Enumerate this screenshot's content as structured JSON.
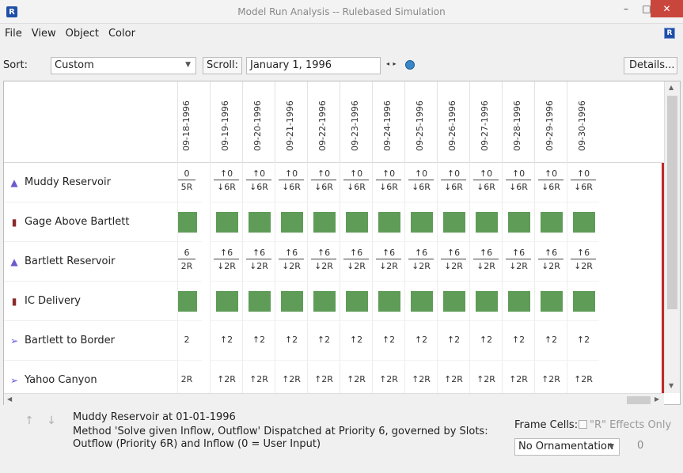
{
  "window": {
    "title": "Model Run Analysis -- Rulebased Simulation",
    "app_icon": "R",
    "minimize": "–",
    "maximize": "□",
    "close": "✕"
  },
  "menu": [
    "File",
    "View",
    "Object",
    "Color"
  ],
  "help_badge": "R",
  "toolbar": {
    "sort_label": "Sort:",
    "sort_value": "Custom",
    "scroll_label": "Scroll:",
    "date_value": "January 1, 1996",
    "nav_arrows": "◂ ▸",
    "details_label": "Details..."
  },
  "columns": [
    "09-18-1996",
    "09-19-1996",
    "09-20-1996",
    "09-21-1996",
    "09-22-1996",
    "09-23-1996",
    "09-24-1996",
    "09-25-1996",
    "09-26-1996",
    "09-27-1996",
    "09-28-1996",
    "09-29-1996",
    "09-30-1996"
  ],
  "rows": [
    {
      "label": "Muddy Reservoir",
      "icon": "reservoir-icon",
      "glyph": "▲",
      "kind": "split",
      "first_top": "0",
      "first_bot": "5R",
      "top": "↑0",
      "bot": "↓6R"
    },
    {
      "label": "Gage Above Bartlett",
      "icon": "gage-icon",
      "glyph": "▮",
      "kind": "green"
    },
    {
      "label": "Bartlett Reservoir",
      "icon": "reservoir-icon",
      "glyph": "▲",
      "kind": "split",
      "first_top": "6",
      "first_bot": "2R",
      "top": "↑6",
      "bot": "↓2R"
    },
    {
      "label": "IC Delivery",
      "icon": "gage-icon",
      "glyph": "▮",
      "kind": "green"
    },
    {
      "label": "Bartlett to Border",
      "icon": "reach-icon",
      "glyph": "➢",
      "kind": "single",
      "first": "2",
      "value": "↑2"
    },
    {
      "label": "Yahoo Canyon",
      "icon": "reach-icon",
      "glyph": "➢",
      "kind": "single",
      "first": "2R",
      "value": "↑2R"
    }
  ],
  "footer": {
    "up_arrow": "↑",
    "down_arrow": "↓",
    "info_title": "Muddy Reservoir at 01-01-1996",
    "info_text": "Method 'Solve given Inflow, Outflow' Dispatched at Priority 6, governed by Slots: Outflow (Priority 6R) and Inflow (0 = User Input)",
    "frame_label": "Frame Cells:",
    "effects_label": "\"R\" Effects Only",
    "ornament_value": "No Ornamentation",
    "spin_value": "0"
  },
  "colors": {
    "cell_green": "#5e9c57",
    "red_marker": "#c0292b",
    "close_red": "#c9463d"
  }
}
